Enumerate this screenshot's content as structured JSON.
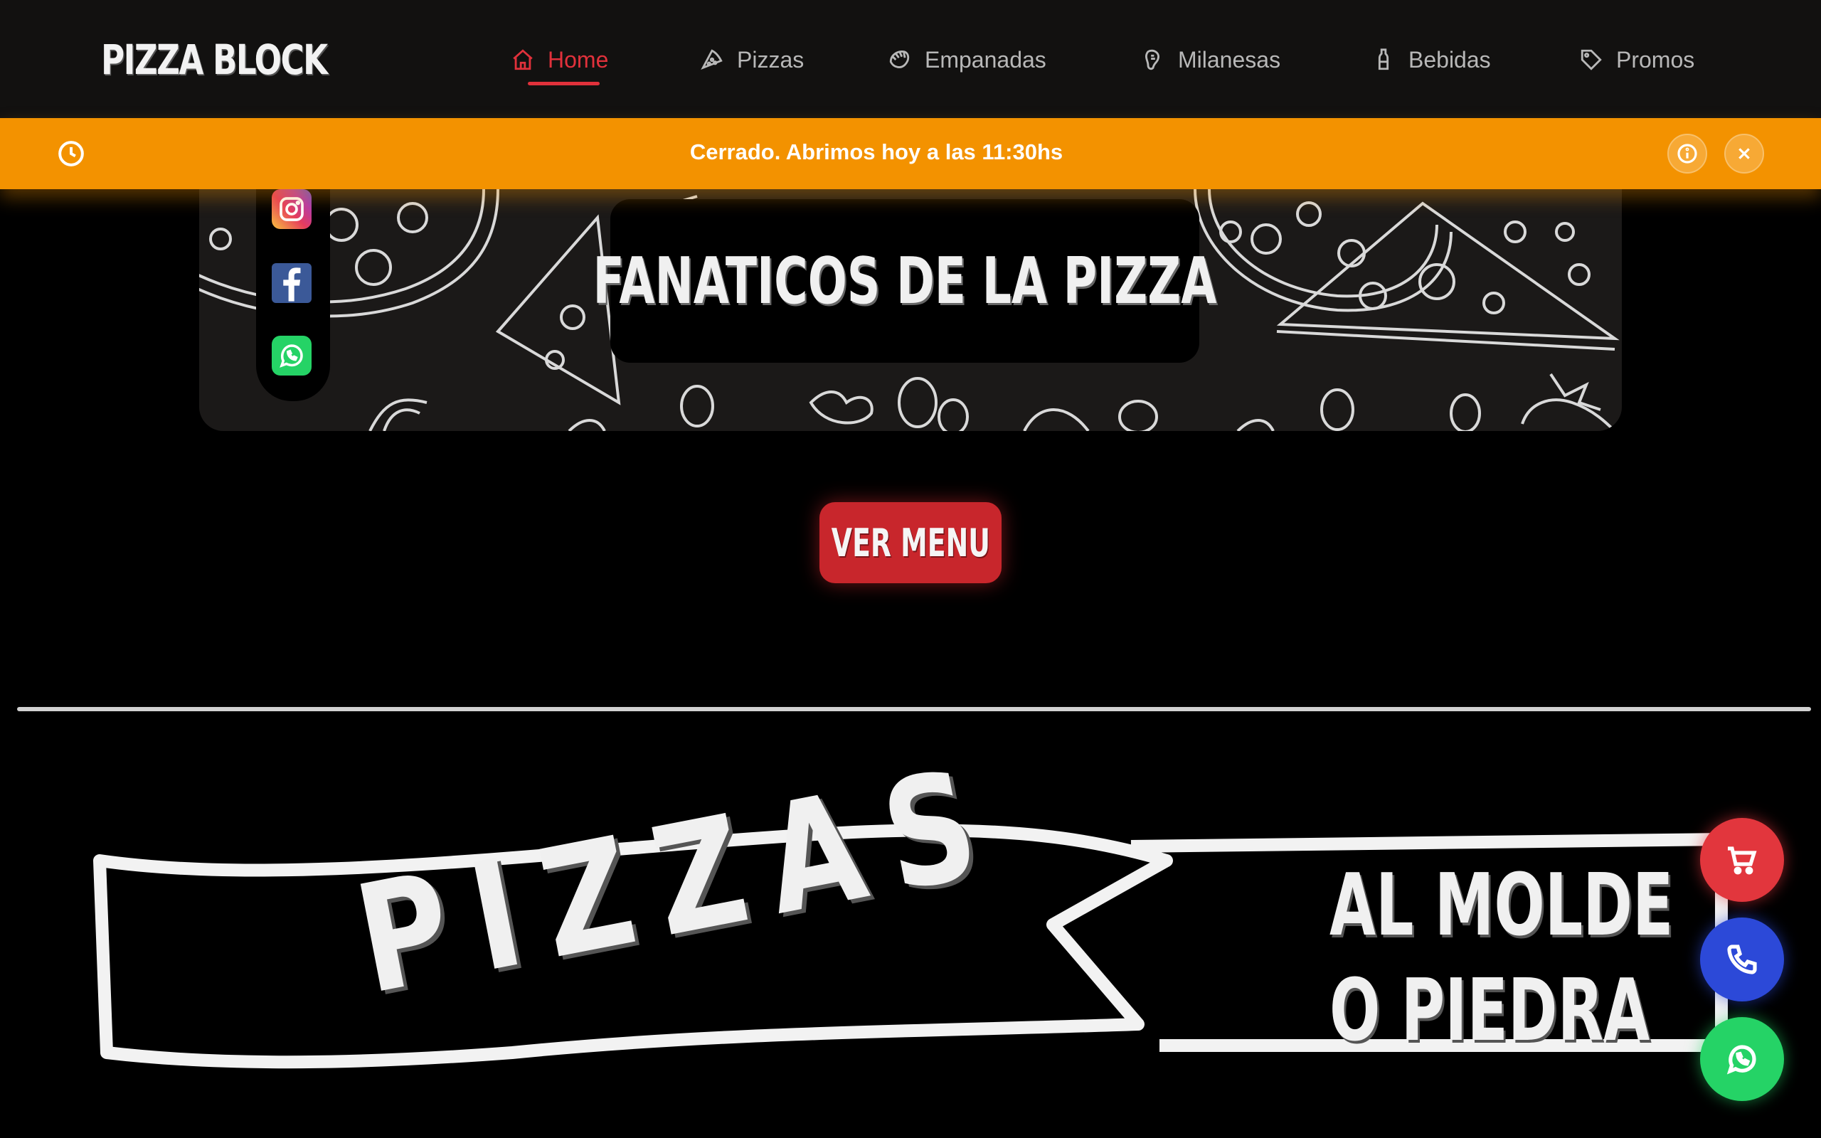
{
  "header": {
    "logo": "PIZZA BLOCK",
    "nav": [
      {
        "label": "Home",
        "icon": "home-icon",
        "active": true
      },
      {
        "label": "Pizzas",
        "icon": "pizza-slice-icon",
        "active": false
      },
      {
        "label": "Empanadas",
        "icon": "empanada-icon",
        "active": false
      },
      {
        "label": "Milanesas",
        "icon": "milanesa-icon",
        "active": false
      },
      {
        "label": "Bebidas",
        "icon": "bottle-icon",
        "active": false
      },
      {
        "label": "Promos",
        "icon": "tag-icon",
        "active": false
      }
    ]
  },
  "notice": {
    "text": "Cerrado. Abrimos hoy a las 11:30hs",
    "icon": "clock-icon",
    "color": "#f39200"
  },
  "hero": {
    "title": "FANATICOS DE LA PIZZA"
  },
  "social": [
    "instagram-icon",
    "facebook-icon",
    "whatsapp-icon"
  ],
  "cta": {
    "label": "VER MENU",
    "color": "#c8262c"
  },
  "section_banner": {
    "main": "PIZZAS",
    "line1": "AL MOLDE",
    "line2": "O PIEDRA"
  },
  "fabs": [
    {
      "name": "cart",
      "icon": "cart-icon",
      "color": "#e2363d"
    },
    {
      "name": "phone",
      "icon": "phone-icon",
      "color": "#2c49d8"
    },
    {
      "name": "whatsapp",
      "icon": "whatsapp-icon",
      "color": "#25d366"
    }
  ],
  "colors": {
    "accent": "#e0313b",
    "header_bg": "#121110"
  }
}
